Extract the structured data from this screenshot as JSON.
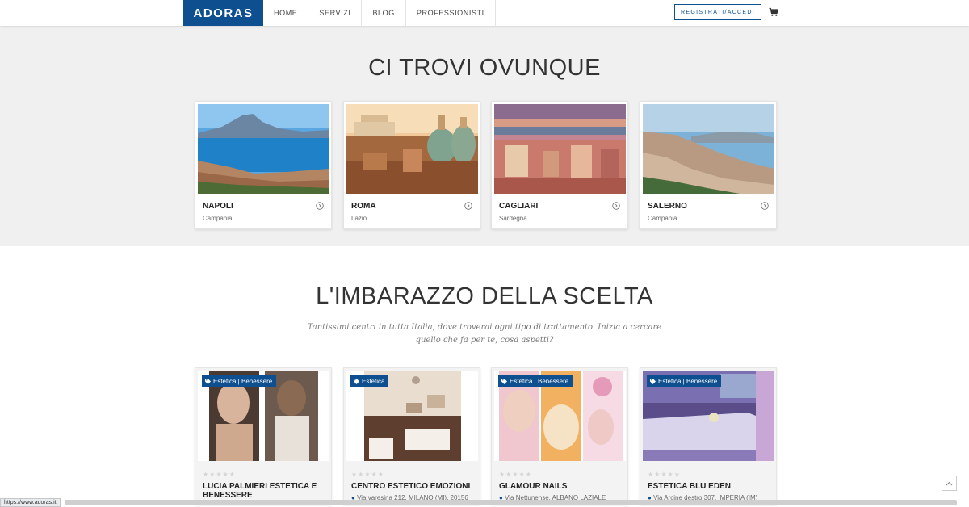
{
  "header": {
    "logo": "ADORAS",
    "nav": [
      "HOME",
      "SERVIZI",
      "BLOG",
      "PROFESSIONISTI"
    ],
    "login_label": "REGISTRATI/ACCEDI",
    "cart_icon": "cart-icon"
  },
  "cities_section": {
    "title": "CI TROVI OVUNQUE",
    "cities": [
      {
        "name": "NAPOLI",
        "region": "Campania"
      },
      {
        "name": "ROMA",
        "region": "Lazio"
      },
      {
        "name": "CAGLIARI",
        "region": "Sardegna"
      },
      {
        "name": "SALERNO",
        "region": "Campania"
      }
    ]
  },
  "choice_section": {
    "title": "L'IMBARAZZO DELLA SCELTA",
    "subtitle": "Tantissimi centri in tutta Italia, dove troverai ogni tipo di trattamento. Inizia a cercare quello che fa per te, cosa aspetti?",
    "businesses": [
      {
        "tag": "Estetica | Benessere",
        "stars": "★★★★★",
        "name": "LUCIA PALMIERI ESTETICA E BENESSERE",
        "address": ""
      },
      {
        "tag": "Estetica",
        "stars": "★★★★★",
        "name": "CENTRO ESTETICO EMOZIONI",
        "address": "Via varesina 212, MILANO (MI), 20156"
      },
      {
        "tag": "Estetica | Benessere",
        "stars": "★★★★★",
        "name": "GLAMOUR NAILS",
        "address": "Via Nettunense, ALBANO LAZIALE"
      },
      {
        "tag": "Estetica | Benessere",
        "stars": "★★★★★",
        "name": "ESTETICA BLU EDEN",
        "address": "Via Arcine destro 307, IMPERIA (IM)"
      }
    ]
  },
  "status_bar": {
    "url": "https://www.adoras.it"
  },
  "colors": {
    "brand": "#0d4f8f",
    "section_bg": "#f0f0f0"
  }
}
